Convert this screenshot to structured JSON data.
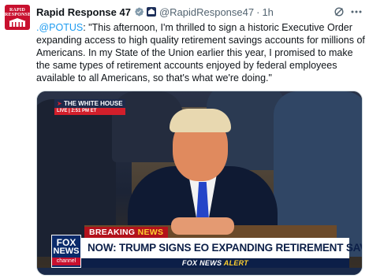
{
  "tweet": {
    "author": {
      "avatar_text": "RAPID RESPONSE",
      "display_name": "Rapid Response 47",
      "handle": "@RapidResponse47",
      "separator": "·",
      "time": "1h"
    },
    "text_mention": ".@POTUS",
    "text_body": ": \"This afternoon, I'm thrilled to sign a historic Executive Order expanding access to high quality retirement savings accounts for millions of Americans. In my State of the Union earlier this year, I promised to make the same types of retirement accounts enjoyed by federal employees available to all Americans, so that's what we're doing.\""
  },
  "media": {
    "white_house_bug": {
      "title": "THE WHITE HOUSE",
      "live": "LIVE | 2:51 PM ET"
    },
    "breaking_prefix": "BREAKING",
    "breaking_suffix": "NEWS",
    "headline": "NOW: TRUMP SIGNS EO EXPANDING RETIREMENT SAVINGS",
    "alert_prefix": "FOX NEWS",
    "alert_suffix": "ALERT",
    "logo": {
      "line1": "FOX",
      "line2": "NEWS",
      "line3": "channel"
    }
  },
  "icons": {
    "verified": "verified-badge-icon",
    "affiliation": "government-affiliation-icon",
    "grok": "grok-icon",
    "more": "more-options-icon"
  },
  "colors": {
    "verified": "#1d9bf0",
    "link": "#1d9bf0",
    "breaking_red": "#b3121b",
    "fox_blue": "#0c1f48"
  }
}
